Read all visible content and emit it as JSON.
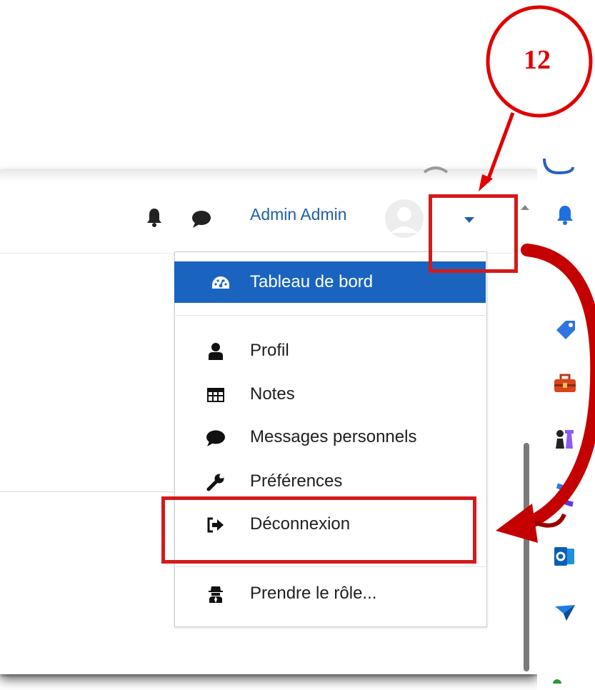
{
  "annotation": {
    "step_number": "12"
  },
  "navbar": {
    "user_name": "Admin Admin",
    "icons": [
      "bell-icon",
      "chat-icon",
      "avatar",
      "caret-down-icon"
    ]
  },
  "user_menu": {
    "items": [
      {
        "label": "Tableau de bord",
        "icon": "dashboard-icon",
        "active": true
      },
      {
        "label": "Profil",
        "icon": "user-icon"
      },
      {
        "label": "Notes",
        "icon": "table-icon"
      },
      {
        "label": "Messages personnels",
        "icon": "comment-icon"
      },
      {
        "label": "Préférences",
        "icon": "wrench-icon"
      },
      {
        "label": "Déconnexion",
        "icon": "sign-out-icon"
      },
      {
        "label": "Prendre le rôle...",
        "icon": "user-secret-icon"
      }
    ]
  },
  "browser_sidebar": {
    "icons": [
      "bell-icon",
      "tag-icon",
      "toolbox-icon",
      "chess-icon",
      "app-icon",
      "outlook-icon",
      "send-icon"
    ]
  },
  "colors": {
    "accent": "#1a64c0",
    "link": "#1f5fa8",
    "annotation_red": "#e00000"
  }
}
